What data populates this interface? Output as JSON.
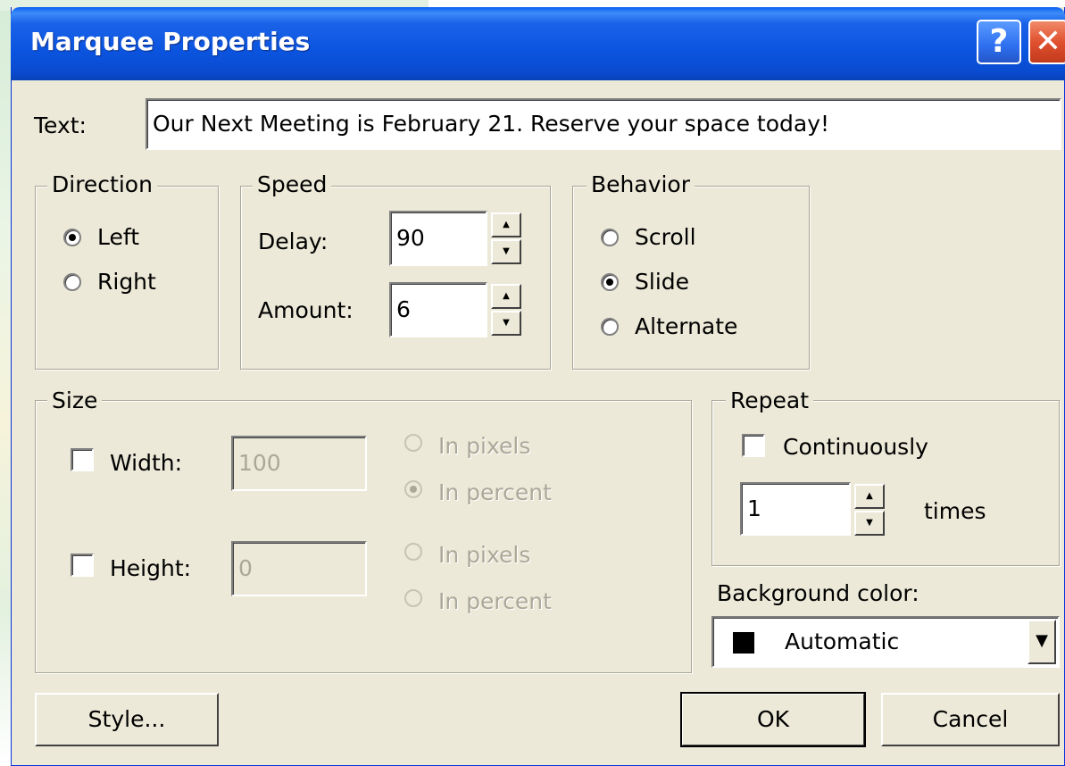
{
  "window": {
    "title": "Marquee Properties",
    "help_label": "?",
    "close_label": "✕"
  },
  "text_field": {
    "label": "Text:",
    "value": "Our Next Meeting is February 21. Reserve your space today!"
  },
  "direction": {
    "legend": "Direction",
    "options": [
      {
        "label": "Left",
        "checked": true
      },
      {
        "label": "Right",
        "checked": false
      }
    ]
  },
  "speed": {
    "legend": "Speed",
    "delay_label": "Delay:",
    "delay_value": "90",
    "amount_label": "Amount:",
    "amount_value": "6"
  },
  "behavior": {
    "legend": "Behavior",
    "options": [
      {
        "label": "Scroll",
        "checked": false
      },
      {
        "label": "Slide",
        "checked": true
      },
      {
        "label": "Alternate",
        "checked": false
      }
    ]
  },
  "size": {
    "legend": "Size",
    "width_label": "Width:",
    "width_value": "100",
    "width_checked": false,
    "width_pixels": "In pixels",
    "width_percent": "In percent",
    "height_label": "Height:",
    "height_value": "0",
    "height_checked": false,
    "height_pixels": "In pixels",
    "height_percent": "In percent"
  },
  "repeat": {
    "legend": "Repeat",
    "continuously_label": "Continuously",
    "continuously_checked": false,
    "count_value": "1",
    "times_label": "times"
  },
  "background": {
    "label": "Background color:",
    "value": "Automatic",
    "swatch_color": "#000000"
  },
  "buttons": {
    "style": "Style...",
    "ok": "OK",
    "cancel": "Cancel"
  },
  "icons": {
    "spin_up": "▲",
    "spin_down": "▼",
    "dropdown": "▼"
  }
}
